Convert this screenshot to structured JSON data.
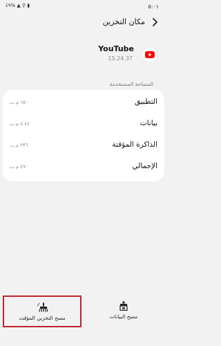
{
  "status_bar": {
    "time": "٥:٠١",
    "icons_text": "٤٩% ▲ ⚲ ▮"
  },
  "header": {
    "title": "مكان التخزين"
  },
  "app": {
    "name": "YouTube",
    "version": "15.24.37",
    "icon": "youtube-play-icon",
    "brand_color": "#ff0000"
  },
  "storage": {
    "section_label": "المساحة المستخدمة",
    "rows": [
      {
        "label": "التطبيق",
        "value": "١٥٠ م.ب"
      },
      {
        "label": "بيانات",
        "value": "٤.٤٤ م.ب"
      },
      {
        "label": "الذاكرة المؤقتة",
        "value": "٣٣٦ م.ب"
      },
      {
        "label": "الإجمالي",
        "value": "٤٩٠ م.ب"
      }
    ]
  },
  "actions": {
    "clear_cache": {
      "label": "مسح التخزين المؤقت",
      "icon": "broom-icon"
    },
    "clear_data": {
      "label": "مسح البيانات",
      "icon": "eraser-icon"
    },
    "highlight_color": "#c0232b"
  }
}
